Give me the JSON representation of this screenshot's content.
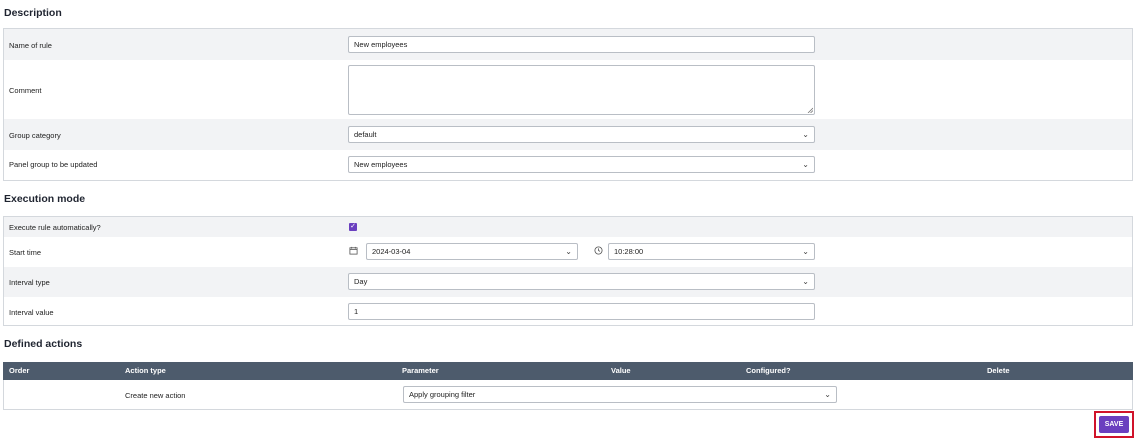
{
  "sections": {
    "description": "Description",
    "execution_mode": "Execution mode",
    "defined_actions": "Defined actions"
  },
  "description": {
    "name_label": "Name of rule",
    "name_value": "New employees",
    "comment_label": "Comment",
    "comment_value": "",
    "group_category_label": "Group category",
    "group_category_value": "default",
    "panel_group_label": "Panel group to be updated",
    "panel_group_value": "New employees"
  },
  "execution": {
    "auto_label": "Execute rule automatically?",
    "auto_checked": true,
    "start_time_label": "Start time",
    "start_date_value": "2024-03-04",
    "start_time_value": "10:28:00",
    "interval_type_label": "Interval type",
    "interval_type_value": "Day",
    "interval_value_label": "Interval value",
    "interval_value_value": "1"
  },
  "actions_table": {
    "columns": [
      "Order",
      "Action type",
      "Parameter",
      "Value",
      "Configured?",
      "Delete"
    ],
    "new_action_label": "Create new action",
    "new_action_select": "Apply grouping filter"
  },
  "save_label": "SAVE",
  "colors": {
    "accent": "#6a3fbf",
    "table_header": "#4d5b6c",
    "highlight_frame": "#d0132a"
  }
}
